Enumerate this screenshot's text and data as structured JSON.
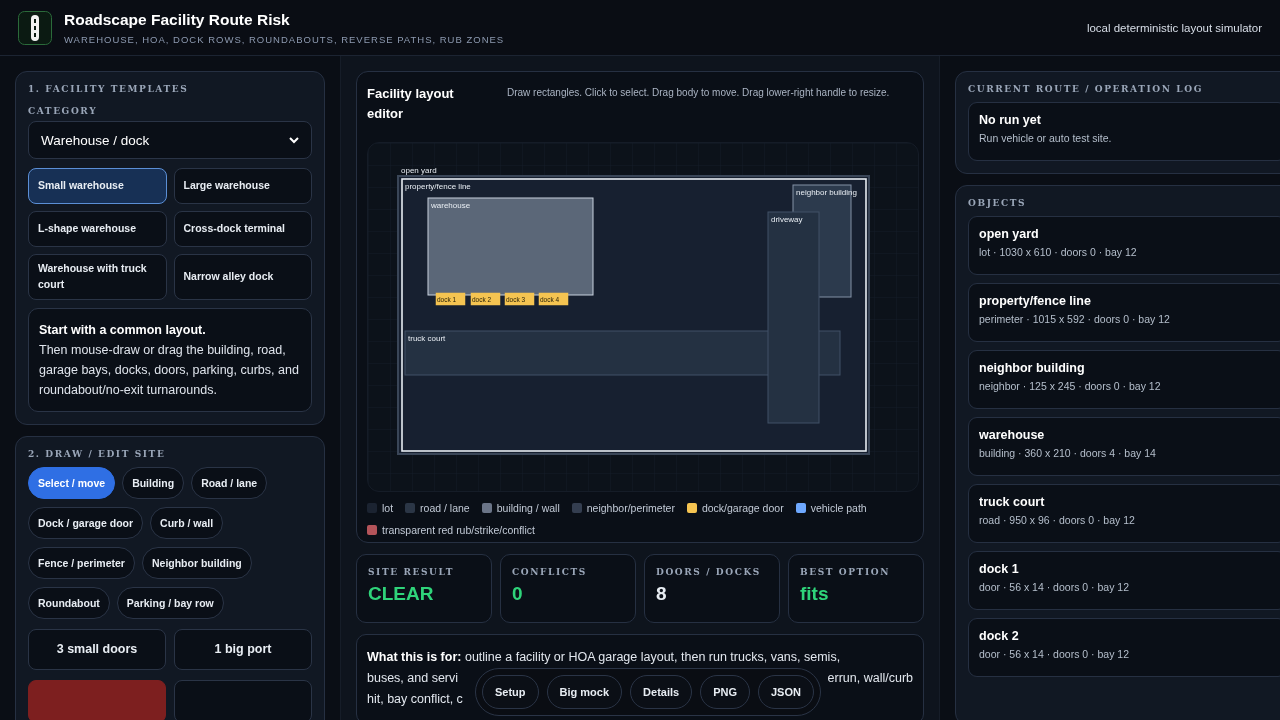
{
  "header": {
    "title": "Roadscape Facility Route Risk",
    "subtitle": "WAREHOUSE, HOA, DOCK ROWS, ROUNDABOUTS, REVERSE PATHS, RUB ZONES",
    "note": "local deterministic layout simulator"
  },
  "templates": {
    "heading": "1. FACILITY TEMPLATES",
    "category_label": "CATEGORY",
    "category_value": "Warehouse / dock",
    "items": [
      {
        "label": "Small warehouse",
        "selected": true
      },
      {
        "label": "Large warehouse",
        "selected": false
      },
      {
        "label": "L-shape warehouse",
        "selected": false
      },
      {
        "label": "Cross-dock terminal",
        "selected": false
      },
      {
        "label": "Warehouse with truck court",
        "selected": false
      },
      {
        "label": "Narrow alley dock",
        "selected": false
      }
    ],
    "hint_title": "Start with a common layout.",
    "hint_body": "Then mouse-draw or drag the building, road, garage bays, docks, doors, parking, curbs, and roundabout/no-exit turnarounds."
  },
  "draw": {
    "heading": "2. DRAW / EDIT SITE",
    "tools": [
      {
        "label": "Select / move",
        "selected": true
      },
      {
        "label": "Building",
        "selected": false
      },
      {
        "label": "Road / lane",
        "selected": false
      },
      {
        "label": "Dock / garage door",
        "selected": false
      },
      {
        "label": "Curb / wall",
        "selected": false
      },
      {
        "label": "Fence / perimeter",
        "selected": false
      },
      {
        "label": "Neighbor building",
        "selected": false
      },
      {
        "label": "Roundabout",
        "selected": false
      },
      {
        "label": "Parking / bay row",
        "selected": false
      }
    ],
    "presets": [
      "3 small doors",
      "1 big port"
    ],
    "more_buttons": [
      {
        "kind": "danger"
      },
      {
        "kind": "plain"
      }
    ]
  },
  "editor": {
    "title": "Facility layout editor",
    "help": "Draw rectangles. Click to select. Drag body to move. Drag lower-right handle to resize.",
    "shapes": [
      {
        "kind": "lot",
        "label": "open yard"
      },
      {
        "kind": "perimeter",
        "label": "property/fence line"
      },
      {
        "kind": "building",
        "label": "warehouse"
      },
      {
        "kind": "neighbor",
        "label": "neighbor building"
      },
      {
        "kind": "road",
        "label": "truck court"
      },
      {
        "kind": "road",
        "label": "driveway"
      },
      {
        "kind": "door",
        "label": "dock 1"
      },
      {
        "kind": "door",
        "label": "dock 2"
      },
      {
        "kind": "door",
        "label": "dock 3"
      },
      {
        "kind": "door",
        "label": "dock 4"
      }
    ],
    "legend": [
      {
        "label": "lot",
        "color": "#1b2331"
      },
      {
        "label": "road / lane",
        "color": "#2b3646"
      },
      {
        "label": "building / wall",
        "color": "#6b7588"
      },
      {
        "label": "neighbor/perimeter",
        "color": "#343e50"
      },
      {
        "label": "dock/garage door",
        "color": "#f5c451"
      },
      {
        "label": "vehicle path",
        "color": "#6ea8fe"
      },
      {
        "label": "transparent red rub/strike/conflict",
        "color": "#b4545a"
      }
    ]
  },
  "stats": [
    {
      "label": "SITE RESULT",
      "value": "CLEAR",
      "good": true
    },
    {
      "label": "CONFLICTS",
      "value": "0",
      "good": true
    },
    {
      "label": "DOORS / DOCKS",
      "value": "8",
      "good": false
    },
    {
      "label": "BEST OPTION",
      "value": "fits",
      "good": true
    }
  ],
  "about": {
    "lead": "What this is for:",
    "line_1": "outline a facility or HOA garage layout, then run trucks, vans, semis,",
    "line_2_left": "buses, and servi",
    "line_2_right": "errun, wall/curb",
    "line_3_left": "hit, bay conflict, c"
  },
  "dock_bar": [
    "Setup",
    "Big mock",
    "Details",
    "PNG",
    "JSON"
  ],
  "log": {
    "heading": "CURRENT ROUTE / OPERATION LOG",
    "title": "No run yet",
    "text": "Run vehicle or auto test site."
  },
  "objects": {
    "heading": "OBJECTS",
    "items": [
      {
        "name": "open yard",
        "meta": "lot · 1030 x 610 · doors 0 · bay 12"
      },
      {
        "name": "property/fence line",
        "meta": "perimeter · 1015 x 592 · doors 0 · bay 12"
      },
      {
        "name": "neighbor building",
        "meta": "neighbor · 125 x 245 · doors 0 · bay 12"
      },
      {
        "name": "warehouse",
        "meta": "building · 360 x 210 · doors 4 · bay 14"
      },
      {
        "name": "truck court",
        "meta": "road · 950 x 96 · doors 0 · bay 12"
      },
      {
        "name": "dock 1",
        "meta": "door · 56 x 14 · doors 0 · bay 12"
      },
      {
        "name": "dock 2",
        "meta": "door · 56 x 14 · doors 0 · bay 12"
      }
    ]
  }
}
